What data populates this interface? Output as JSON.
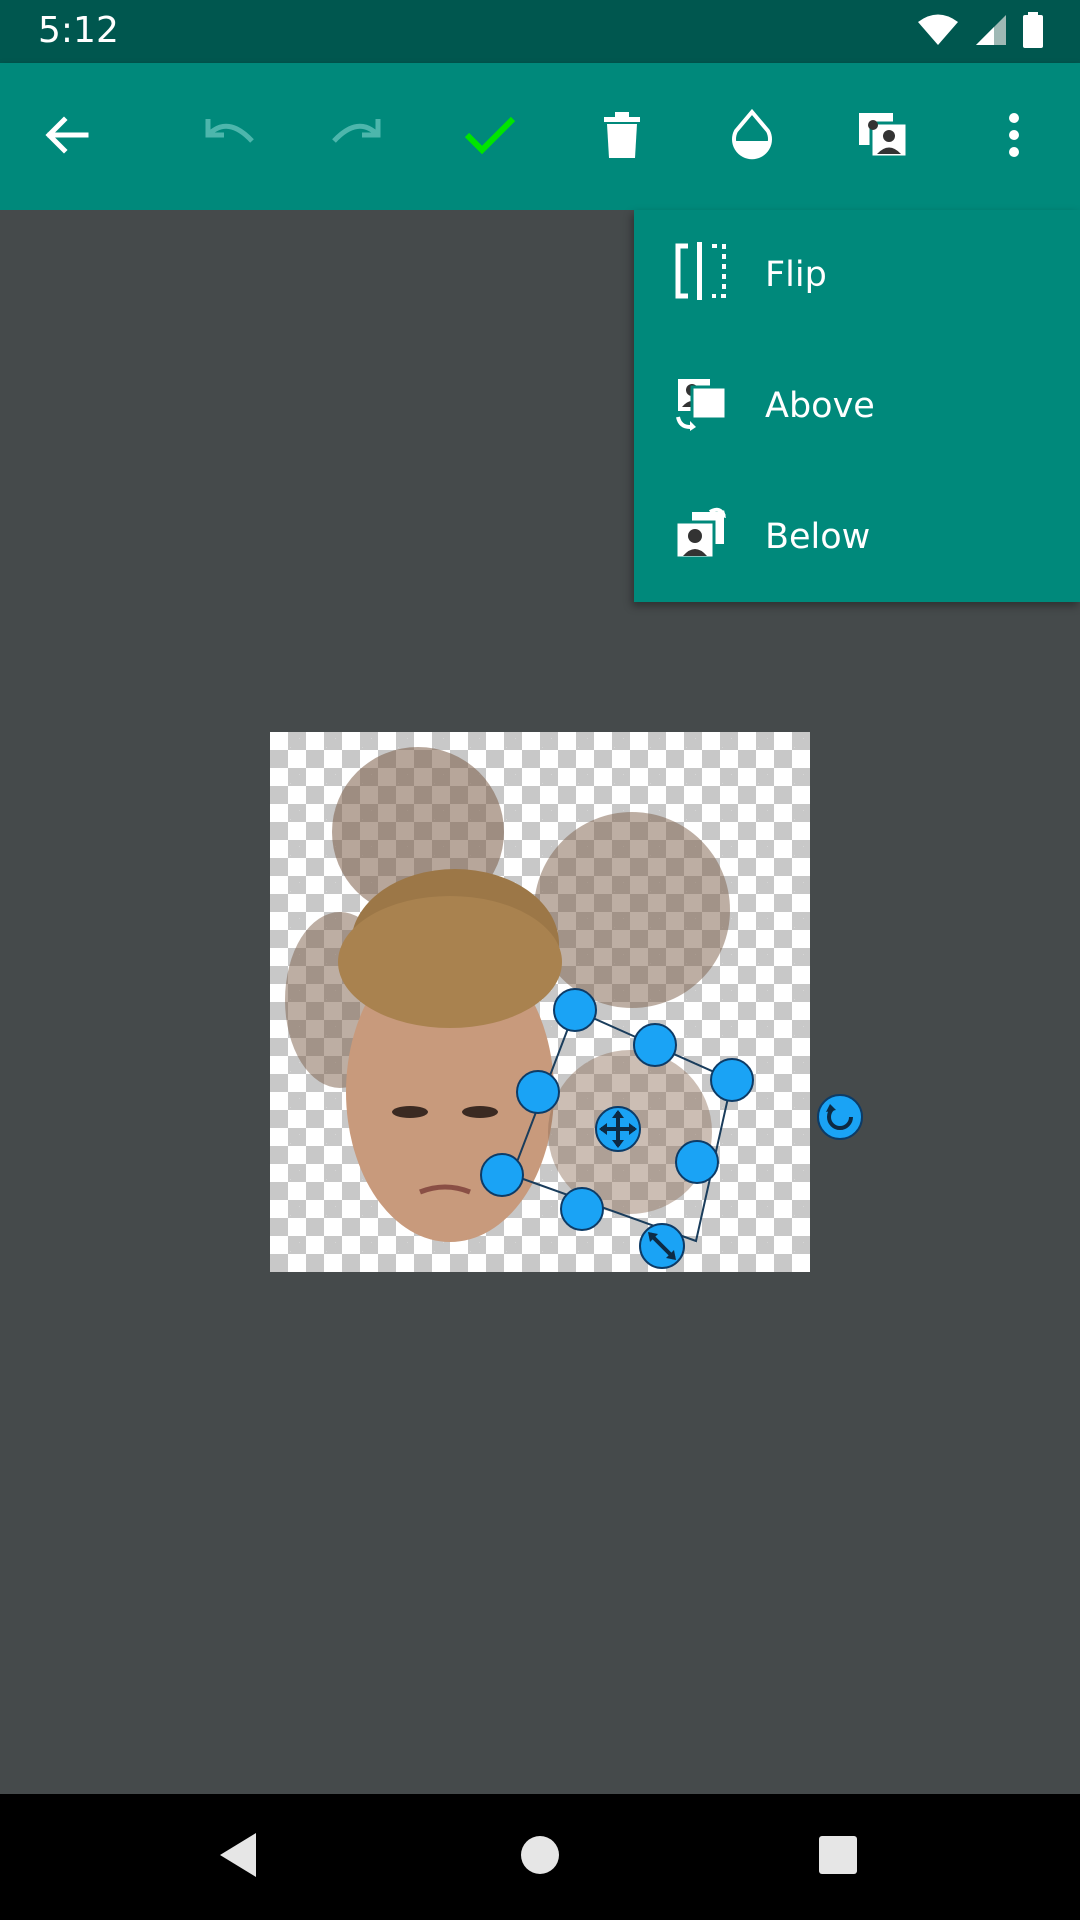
{
  "status_bar": {
    "time": "5:12",
    "icons": [
      "wifi-icon",
      "cellular-signal-icon",
      "battery-icon"
    ]
  },
  "toolbar": {
    "buttons": [
      {
        "name": "back-button",
        "icon": "arrow-left-icon",
        "enabled": true
      },
      {
        "name": "undo-button",
        "icon": "undo-icon",
        "enabled": false
      },
      {
        "name": "redo-button",
        "icon": "redo-icon",
        "enabled": false
      },
      {
        "name": "confirm-button",
        "icon": "check-icon",
        "enabled": true,
        "color": "#00e500"
      },
      {
        "name": "delete-button",
        "icon": "trash-icon",
        "enabled": true
      },
      {
        "name": "opacity-button",
        "icon": "drop-icon",
        "enabled": true
      },
      {
        "name": "layers-button",
        "icon": "layers-icon",
        "enabled": true
      },
      {
        "name": "overflow-menu-button",
        "icon": "more-vert-icon",
        "enabled": true
      }
    ]
  },
  "overflow_menu": {
    "items": [
      {
        "label": "Flip",
        "icon": "flip-icon"
      },
      {
        "label": "Above",
        "icon": "bring-forward-icon"
      },
      {
        "label": "Below",
        "icon": "send-backward-icon"
      }
    ]
  },
  "canvas": {
    "background": "transparent-checkerboard",
    "selection_color": "#1aa3f5",
    "handles": [
      "move-handle-icon",
      "resize-handle-icon",
      "rotate-handle-icon"
    ]
  },
  "colors": {
    "toolbar": "#00897b",
    "status_bar": "#00574f",
    "workspace": "#454a4b",
    "accent_check": "#00e500"
  },
  "nav_bar": {
    "buttons": [
      "nav-back-icon",
      "nav-home-icon",
      "nav-recents-icon"
    ]
  }
}
